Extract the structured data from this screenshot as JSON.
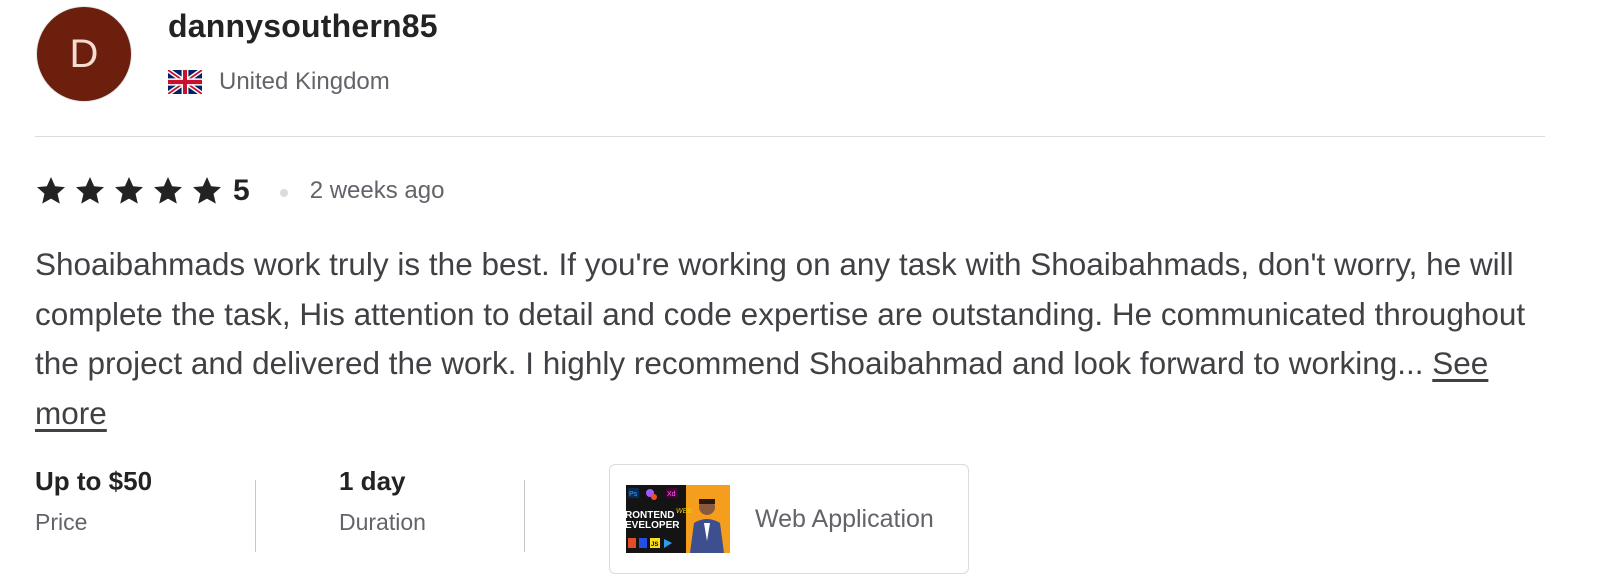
{
  "reviewer": {
    "avatar_initial": "D",
    "username": "dannysouthern85",
    "country": "United Kingdom",
    "flag_icon": "uk-flag-icon",
    "avatar_color": "#6b1f0c"
  },
  "review": {
    "stars_filled": 5,
    "rating": "5",
    "time_ago": "2 weeks ago",
    "text": "Shoaibahmads work truly is the best. If you're working on any task with Shoaibahmads, don't worry, he will complete the task, His attention to detail and code expertise are outstanding. He communicated throughout the project and delivered the work. I highly recommend Shoaibahmad and look forward to working...",
    "see_more_label": "See more"
  },
  "order": {
    "price_value": "Up to $50",
    "price_label": "Price",
    "duration_value": "1 day",
    "duration_label": "Duration"
  },
  "gig": {
    "title": "Web Application",
    "thumb_badges": [
      "Ps",
      "Xd",
      "JS"
    ],
    "thumb_text_line1": "RONTEND",
    "thumb_text_line2": "EVELOPER",
    "thumb_text_web": "WEB"
  },
  "colors": {
    "star": "#222325",
    "text": "#404145",
    "muted": "#62646a",
    "divider": "#dadbdd"
  }
}
